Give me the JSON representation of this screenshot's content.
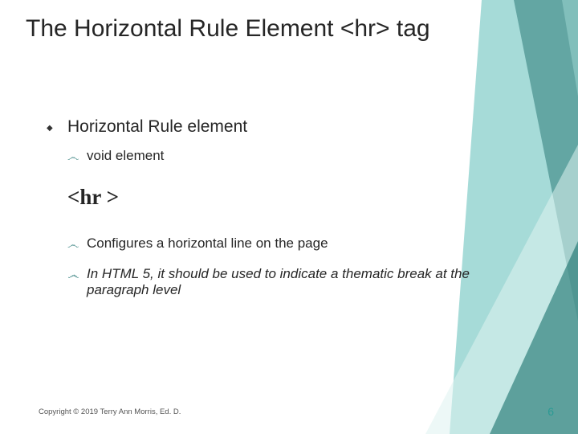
{
  "title": "The Horizontal Rule Element <hr> tag",
  "bullets": {
    "main": "Horizontal Rule element",
    "sub_void": "void element",
    "hr_tag": "<hr >",
    "sub_config": "Configures a horizontal line on the page",
    "sub_html5": "In HTML 5, it should be used to indicate a thematic break at the paragraph level"
  },
  "copyright": "Copyright © 2019 Terry Ann Morris, Ed. D.",
  "page_number": "6"
}
